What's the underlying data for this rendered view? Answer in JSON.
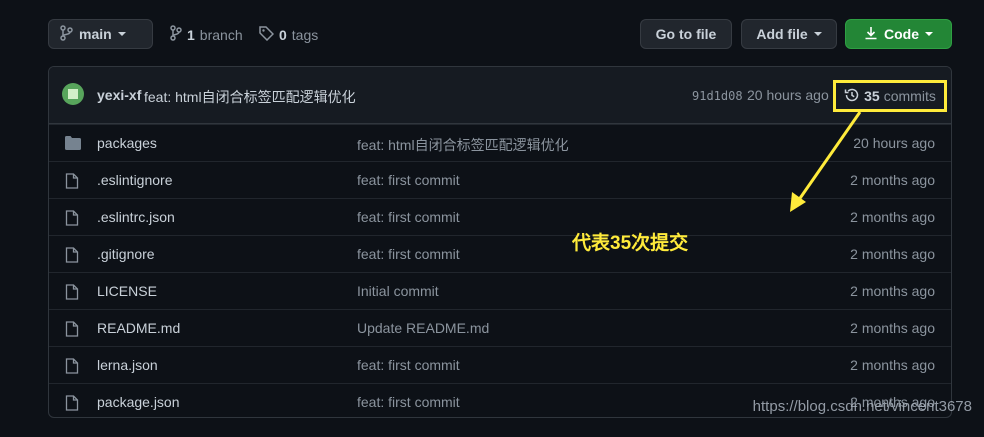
{
  "toolbar": {
    "branch_label": "main",
    "branch_count": "1",
    "branch_word": "branch",
    "tag_count": "0",
    "tag_word": "tags",
    "goto_label": "Go to file",
    "add_label": "Add file",
    "code_label": "Code"
  },
  "commit": {
    "author": "yexi-xf",
    "message": "feat: html自闭合标签匹配逻辑优化",
    "sha": "91d1d08",
    "time": "20 hours ago",
    "commit_count": "35",
    "commit_word": "commits"
  },
  "files": [
    {
      "name": "packages",
      "type": "folder",
      "message": "feat: html自闭合标签匹配逻辑优化",
      "time": "20 hours ago"
    },
    {
      "name": ".eslintignore",
      "type": "file",
      "message": "feat: first commit",
      "time": "2 months ago"
    },
    {
      "name": ".eslintrc.json",
      "type": "file",
      "message": "feat: first commit",
      "time": "2 months ago"
    },
    {
      "name": ".gitignore",
      "type": "file",
      "message": "feat: first commit",
      "time": "2 months ago"
    },
    {
      "name": "LICENSE",
      "type": "file",
      "message": "Initial commit",
      "time": "2 months ago"
    },
    {
      "name": "README.md",
      "type": "file",
      "message": "Update README.md",
      "time": "2 months ago"
    },
    {
      "name": "lerna.json",
      "type": "file",
      "message": "feat: first commit",
      "time": "2 months ago"
    },
    {
      "name": "package.json",
      "type": "file",
      "message": "feat: first commit",
      "time": "2 months ago"
    }
  ],
  "annotation": "代表35次提交",
  "watermark": "https://blog.csdn.net/vincent3678",
  "colors": {
    "background": "#0d1117",
    "code_button": "#238636",
    "highlight": "#ffeb3b"
  }
}
